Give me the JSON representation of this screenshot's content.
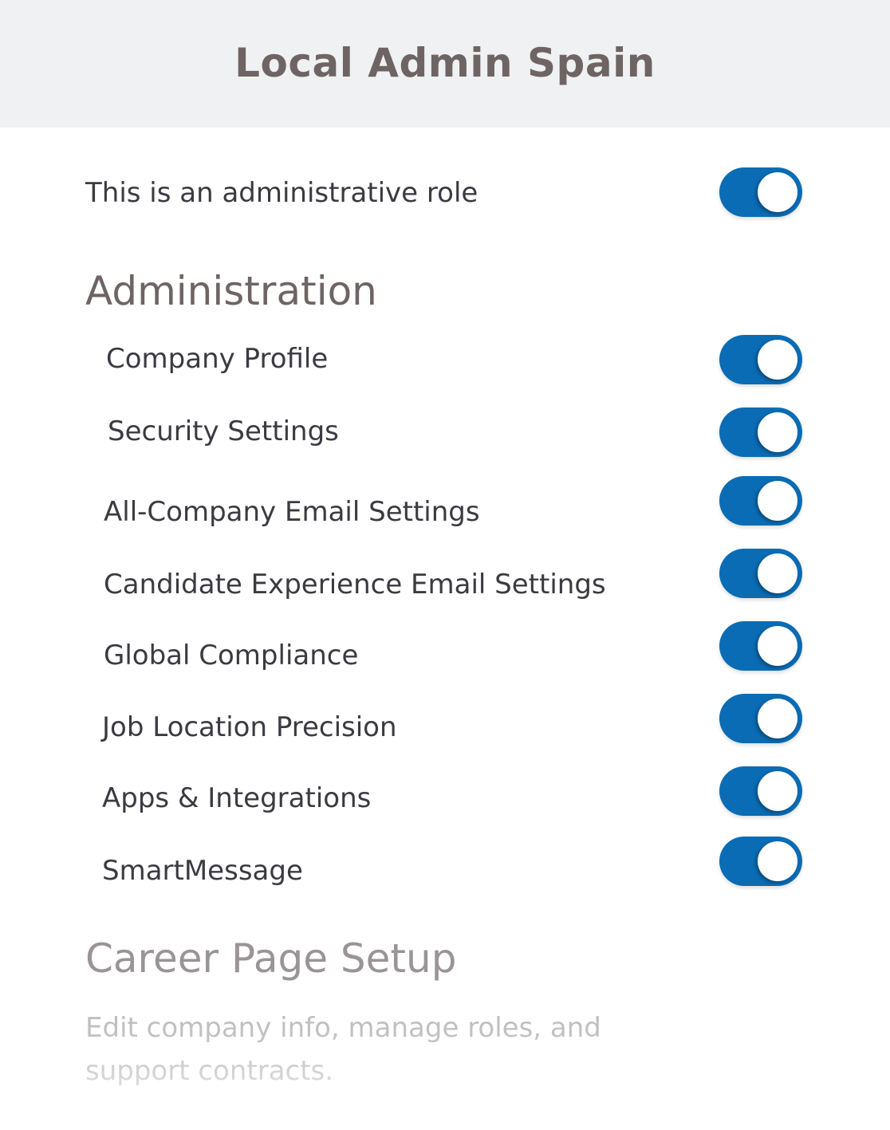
{
  "header": {
    "title": "Local Admin Spain"
  },
  "admin_role": {
    "label": "This is an administrative role",
    "enabled": true
  },
  "sections": [
    {
      "title": "Administration",
      "items": [
        {
          "label": "Company Profile",
          "enabled": true
        },
        {
          "label": "Security Settings",
          "enabled": true
        },
        {
          "label": "All-Company Email Settings",
          "enabled": true
        },
        {
          "label": "Candidate Experience Email Settings",
          "enabled": true
        },
        {
          "label": "Global Compliance",
          "enabled": true
        },
        {
          "label": "Job Location Precision",
          "enabled": true
        },
        {
          "label": "Apps & Integrations",
          "enabled": true
        },
        {
          "label": "SmartMessage",
          "enabled": true
        }
      ]
    },
    {
      "title": "Career Page Setup",
      "description": "Edit company info, manage roles, and support contracts."
    }
  ],
  "colors": {
    "toggle_on": "#0a6cb4",
    "header_bg": "#f0f1f3",
    "title_text": "#6e6464"
  }
}
